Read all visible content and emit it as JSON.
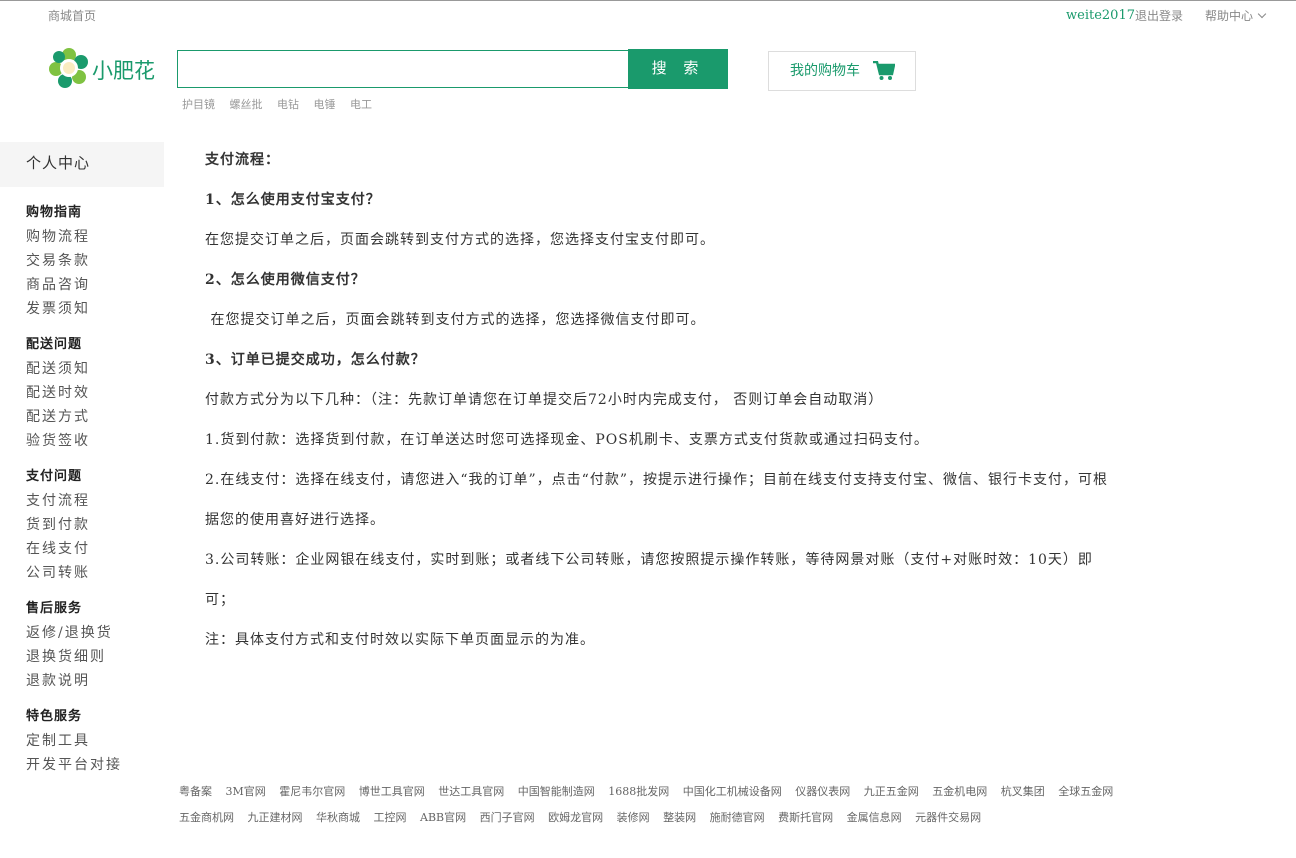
{
  "topbar": {
    "home": "商城首页",
    "user": "weite2017",
    "logout": "退出登录",
    "help": "帮助中心"
  },
  "logo": {
    "text": "小肥花",
    "color": "#1a9a6c"
  },
  "search": {
    "value": "",
    "placeholder": "",
    "button": "搜 索",
    "hot_words": [
      "护目镜",
      "螺丝批",
      "电钻",
      "电锤",
      "电工"
    ]
  },
  "cart": {
    "label": "我的购物车",
    "icon": "cart-icon"
  },
  "sidebar": {
    "title": "个人中心",
    "groups": [
      {
        "title": "购物指南",
        "items": [
          "购物流程",
          "交易条款",
          "商品咨询",
          "发票须知"
        ]
      },
      {
        "title": "配送问题",
        "items": [
          "配送须知",
          "配送时效",
          "配送方式",
          "验货签收"
        ]
      },
      {
        "title": "支付问题",
        "items": [
          "支付流程",
          "货到付款",
          "在线支付",
          "公司转账"
        ]
      },
      {
        "title": "售后服务",
        "items": [
          "返修/退换货",
          "退换货细则",
          "退款说明"
        ]
      },
      {
        "title": "特色服务",
        "items": [
          "定制工具",
          "开发平台对接"
        ]
      }
    ]
  },
  "content": {
    "heading": "支付流程：",
    "q1": "1、怎么使用支付宝支付？",
    "a1": "在您提交订单之后，页面会跳转到支付方式的选择，您选择支付宝支付即可。",
    "q2": "2、怎么使用微信支付？",
    "a2": " 在您提交订单之后，页面会跳转到支付方式的选择，您选择微信支付即可。",
    "q3": "3、订单已提交成功，怎么付款？",
    "a3_intro": "付款方式分为以下几种：（注：先款订单请您在订单提交后72小时内完成支付， 否则订单会自动取消）",
    "a3_1": "1.货到付款：选择货到付款，在订单送达时您可选择现金、POS机刷卡、支票方式支付货款或通过扫码支付。",
    "a3_2_line1": "2.在线支付：选择在线支付，请您进入“我的订单”，点击“付款”，按提示进行操作；目前在线支付支持支付宝、微信、银行卡支付，可根",
    "a3_2_line2": "据您的使用喜好进行选择。",
    "a3_3_line1": "3.公司转账：企业网银在线支付，实时到账；或者线下公司转账，请您按照提示操作转账，等待网景对账（支付+对账时效：10天）即",
    "a3_3_line2": "可；",
    "note": "注：具体支付方式和支付时效以实际下单页面显示的为准。"
  },
  "footer": {
    "row1": [
      "粤备案",
      "3M官网",
      "霍尼韦尔官网",
      "博世工具官网",
      "世达工具官网",
      "中国智能制造网",
      "1688批发网",
      "中国化工机械设备网",
      "仪器仪表网",
      "九正五金网",
      "五金机电网",
      "杭叉集团",
      "全球五金网"
    ],
    "row2": [
      "五金商机网",
      "九正建材网",
      "华秋商城",
      "工控网",
      "ABB官网",
      "西门子官网",
      "欧姆龙官网",
      "装修网",
      "整装网",
      "施耐德官网",
      "费斯托官网",
      "金属信息网",
      "元器件交易网"
    ]
  }
}
